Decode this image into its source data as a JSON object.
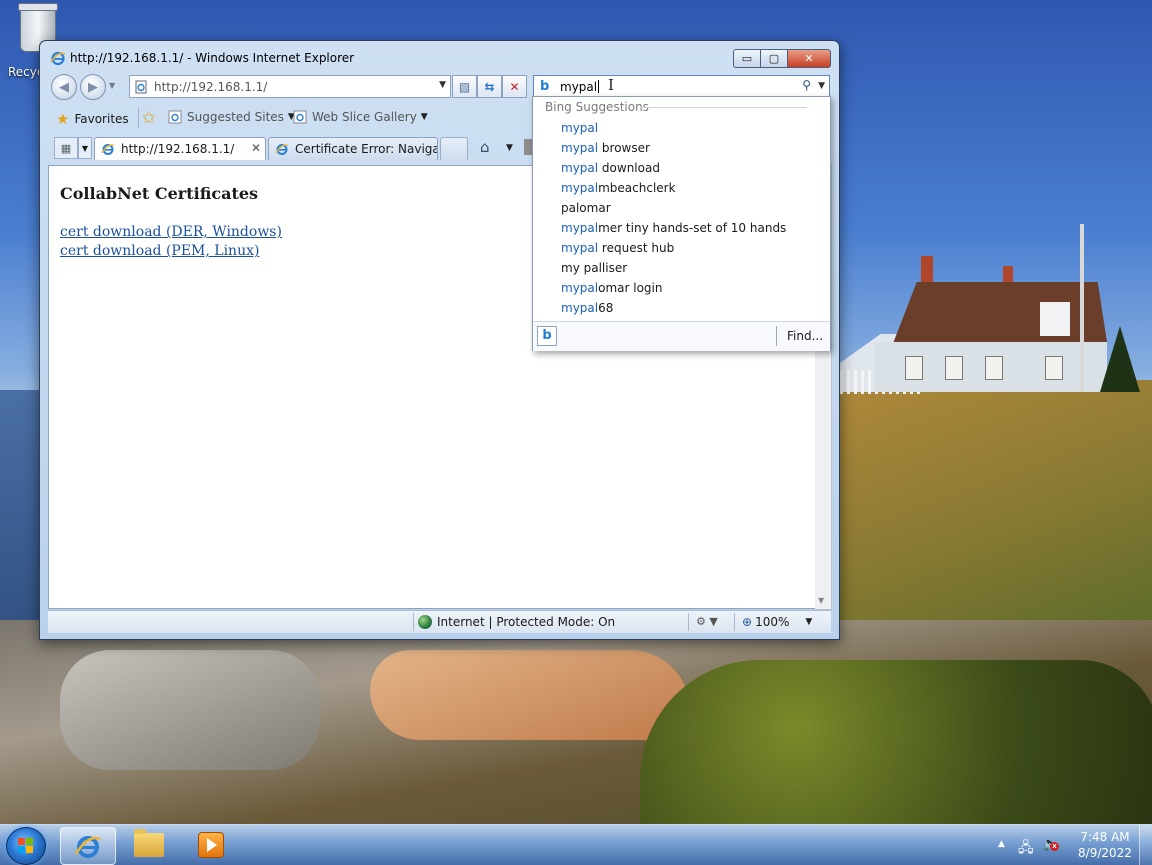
{
  "desktop": {
    "recycle_bin_label": "Recycle Bin"
  },
  "window": {
    "title": "http://192.168.1.1/ - Windows Internet Explorer",
    "controls": {
      "minimize": "▭",
      "maximize": "▢",
      "close": "✕"
    }
  },
  "nav": {
    "address": "http://192.168.1.1/",
    "search_query": "mypal"
  },
  "favorites_bar": {
    "favorites_label": "Favorites",
    "suggested_sites_label": "Suggested Sites",
    "web_slice_gallery_label": "Web Slice Gallery"
  },
  "tabs": [
    {
      "label": "http://192.168.1.1/",
      "active": true
    },
    {
      "label": "Certificate Error: Navigati...",
      "active": false
    }
  ],
  "page": {
    "heading": "CollabNet Certificates",
    "links": [
      "cert download (DER, Windows)",
      "cert download (PEM, Linux)"
    ]
  },
  "status_bar": {
    "zone": "Internet | Protected Mode: On",
    "zoom": "100%"
  },
  "suggestions": {
    "header": "Bing Suggestions",
    "items": [
      {
        "match": "mypal",
        "rest": ""
      },
      {
        "match": "mypal",
        "rest": " browser"
      },
      {
        "match": "mypal",
        "rest": " download"
      },
      {
        "match": "mypal",
        "rest": "mbeachclerk"
      },
      {
        "match": "",
        "rest": "palomar"
      },
      {
        "match": "mypal",
        "rest": "mer tiny hands-set of 10 hands"
      },
      {
        "match": "mypal",
        "rest": " request hub"
      },
      {
        "match": "",
        "rest": "my palliser"
      },
      {
        "match": "mypal",
        "rest": "omar login"
      },
      {
        "match": "mypal",
        "rest": "68"
      }
    ],
    "find_label": "Find..."
  },
  "taskbar": {
    "time": "7:48 AM",
    "date": "8/9/2022"
  },
  "colors": {
    "link": "#1a4f9c",
    "suggestion_match": "#1c5fb8",
    "close_button": "#c63c22"
  },
  "icons": {
    "window": "ie-icon",
    "back": "back-arrow-icon",
    "forward": "forward-arrow-icon",
    "search_provider": "bing-icon",
    "search_go": "magnifier-icon",
    "favorites": "star-icon",
    "home": "home-icon",
    "zone": "globe-icon",
    "zoom": "zoom-icon"
  }
}
